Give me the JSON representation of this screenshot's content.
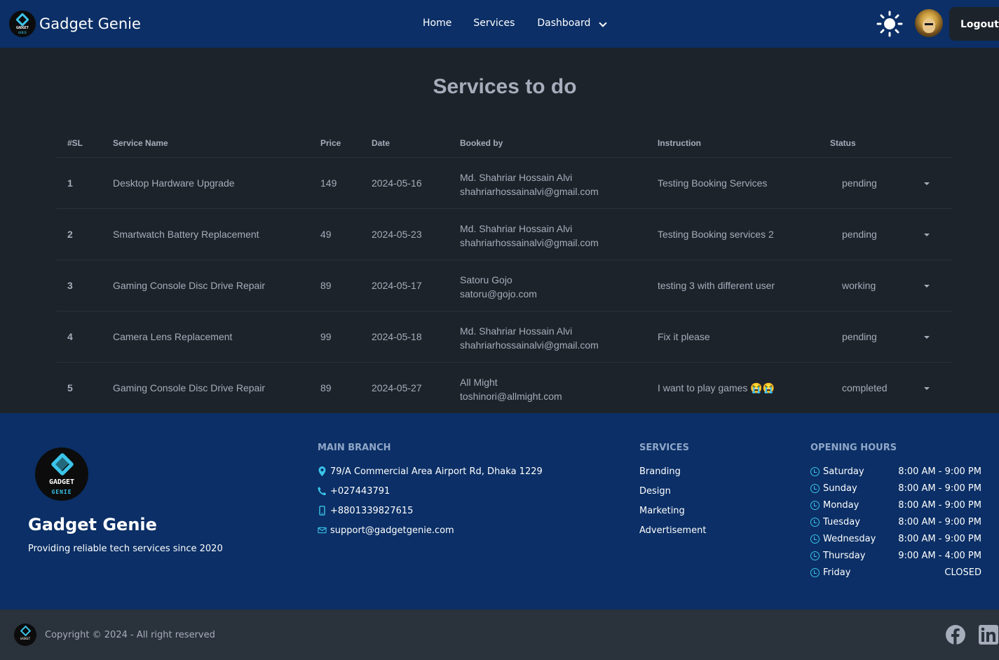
{
  "navbar": {
    "brand": "Gadget Genie",
    "logo_text_top": "GADGET",
    "logo_text_bottom": "GENIE",
    "links": [
      "Home",
      "Services",
      "Dashboard"
    ],
    "theme_icon": "sun-icon",
    "logout_label": "Logout"
  },
  "page": {
    "title": "Services to do"
  },
  "table": {
    "headers": [
      "#SL",
      "Service Name",
      "Price",
      "Date",
      "Booked by",
      "Instruction",
      "Status"
    ],
    "rows": [
      {
        "sl": "1",
        "name": "Desktop Hardware Upgrade",
        "price": "149",
        "date": "2024-05-16",
        "booked_name": "Md. Shahriar Hossain Alvi",
        "booked_email": "shahriarhossainalvi@gmail.com",
        "instruction": "Testing Booking Services",
        "status": "pending"
      },
      {
        "sl": "2",
        "name": "Smartwatch Battery Replacement",
        "price": "49",
        "date": "2024-05-23",
        "booked_name": "Md. Shahriar Hossain Alvi",
        "booked_email": "shahriarhossainalvi@gmail.com",
        "instruction": "Testing Booking services 2",
        "status": "pending"
      },
      {
        "sl": "3",
        "name": "Gaming Console Disc Drive Repair",
        "price": "89",
        "date": "2024-05-17",
        "booked_name": "Satoru Gojo",
        "booked_email": "satoru@gojo.com",
        "instruction": "testing 3 with different user",
        "status": "working"
      },
      {
        "sl": "4",
        "name": "Camera Lens Replacement",
        "price": "99",
        "date": "2024-05-18",
        "booked_name": "Md. Shahriar Hossain Alvi",
        "booked_email": "shahriarhossainalvi@gmail.com",
        "instruction": "Fix it please",
        "status": "pending"
      },
      {
        "sl": "5",
        "name": "Gaming Console Disc Drive Repair",
        "price": "89",
        "date": "2024-05-27",
        "booked_name": "All Might",
        "booked_email": "toshinori@allmight.com",
        "instruction": "I want to play games 😭😭",
        "status": "completed"
      }
    ]
  },
  "footer": {
    "logo_text_top": "GADGET",
    "logo_text_bottom": "GENIE",
    "brand": "Gadget Genie",
    "tagline": "Providing reliable tech services since 2020",
    "main_branch": {
      "heading": "MAIN BRANCH",
      "address": "79/A Commercial Area Airport Rd, Dhaka 1229",
      "phone": "+027443791",
      "mobile": "+8801339827615",
      "email": "support@gadgetgenie.com"
    },
    "services": {
      "heading": "SERVICES",
      "items": [
        "Branding",
        "Design",
        "Marketing",
        "Advertisement"
      ]
    },
    "opening_hours": {
      "heading": "OPENING HOURS",
      "days": [
        {
          "day": "Saturday",
          "time": "8:00 AM - 9:00 PM"
        },
        {
          "day": "Sunday",
          "time": "8:00 AM - 9:00 PM"
        },
        {
          "day": "Monday",
          "time": "8:00 AM - 9:00 PM"
        },
        {
          "day": "Tuesday",
          "time": "8:00 AM - 9:00 PM"
        },
        {
          "day": "Wednesday",
          "time": "8:00 AM - 9:00 PM"
        },
        {
          "day": "Thursday",
          "time": "9:00 AM - 4:00 PM"
        },
        {
          "day": "Friday",
          "time": "CLOSED"
        }
      ]
    }
  },
  "bottombar": {
    "copyright": "Copyright © 2024 - All right reserved",
    "social_icons": [
      "facebook-icon",
      "linkedin-icon"
    ]
  },
  "colors": {
    "navy": "#0b2f66",
    "background": "#1d232a",
    "accent": "#3bc4ea",
    "text": "#a6adbb"
  }
}
